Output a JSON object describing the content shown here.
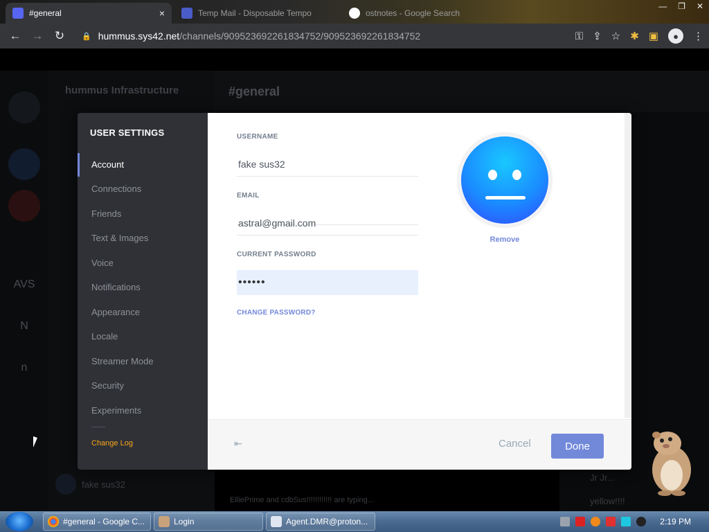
{
  "browser": {
    "tabs": [
      {
        "title": "#general",
        "active": true,
        "close": "×"
      },
      {
        "title": "Temp Mail - Disposable Tempo",
        "active": false
      },
      {
        "title": "ostnotes - Google Search",
        "active": false
      }
    ],
    "window_controls": {
      "min": "—",
      "max": "❐",
      "close": "✕"
    },
    "url_host": "hummus.sys42.net",
    "url_path": "/channels/909523692261834752/909523692261834752",
    "icons": {
      "back": "←",
      "forward": "→",
      "reload": "↻",
      "lock": "🔒",
      "key": "⚿",
      "share": "⇪",
      "star": "☆",
      "extensions": "✱",
      "sidebar": "▣",
      "profile": "●",
      "menu": "⋮"
    }
  },
  "background": {
    "server_name": "hummus Infrastructure",
    "channel_name": "#general",
    "guilds": [
      "",
      "",
      "",
      "AVS",
      "N",
      "n"
    ],
    "user_name": "fake sus32",
    "typing": "ElliePrime and cdbSus!!!!!!!!!!!! are typing...",
    "members": [
      "Jr Jr...",
      "yellow!!!!"
    ]
  },
  "settings": {
    "title": "USER SETTINGS",
    "nav": [
      {
        "label": "Account",
        "active": true
      },
      {
        "label": "Connections"
      },
      {
        "label": "Friends"
      },
      {
        "label": "Text & Images"
      },
      {
        "label": "Voice"
      },
      {
        "label": "Notifications"
      },
      {
        "label": "Appearance"
      },
      {
        "label": "Locale"
      },
      {
        "label": "Streamer Mode"
      },
      {
        "label": "Security"
      },
      {
        "label": "Experiments"
      }
    ],
    "changelog": "Change Log",
    "username_label": "USERNAME",
    "username_value": "fake sus32",
    "email_label": "EMAIL",
    "email_value": "astral@gmail.com",
    "password_label": "CURRENT PASSWORD",
    "password_value": "••••••",
    "change_password": "CHANGE PASSWORD?",
    "avatar_remove": "Remove",
    "logout_icon": "⇤",
    "cancel": "Cancel",
    "done": "Done",
    "accent": "#7289da"
  },
  "taskbar": {
    "items": [
      {
        "label": "#general - Google C..."
      },
      {
        "label": "Login"
      },
      {
        "label": "Agent.DMR@proton..."
      }
    ],
    "clock": "2:19 PM"
  }
}
